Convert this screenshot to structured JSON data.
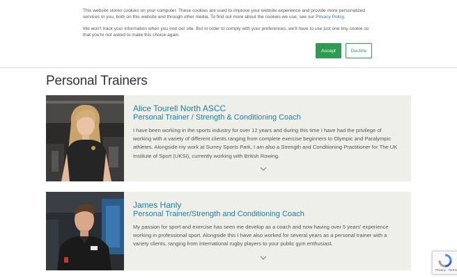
{
  "cookie_banner": {
    "paragraph_1_text": "This website stores cookies on your computer. These cookies are used to improve your website experience and provide more personalized services to you, both on this website and through other media. To find out more about the cookies we use, see our ",
    "policy_link": "Privacy Policy",
    "paragraph_1_end": ".",
    "paragraph_2": "We won't track your information when you visit our site. But in order to comply with your preferences, we'll have to use just one tiny cookie so that you're not asked to make this choice again.",
    "accept_label": "Accept",
    "decline_label": "Decline",
    "accept_color": "#2f9a54"
  },
  "page": {
    "section_title": "Personal Trainers"
  },
  "trainers": [
    {
      "name": "Alice Tourell North ASCC",
      "role": "Personal Trainer / Strength & Conditioning Coach",
      "bio": "I have been working in the sports industry for over 12 years and during this time I have had the privilege of working with a variety of different clients ranging from complete exercise beginners to Olympic and Paralympic athletes. Alongside my work at Surrey Sports Park, I am also a Strength and Conditioning Practitioner for The UK Institute of Sport (UKSI), currently working with British Rowing."
    },
    {
      "name": "James Hanly",
      "role": "Personal Trainer/Strength and Conditioning Coach",
      "bio": "My passion for sport and exercise has seen me develop as a coach and now having over 5 years' experience working in professional sport. Alongside this I have also worked for several years as a personal trainer with a variety clients, ranging from international rugby players to your public gym enthusiast."
    }
  ],
  "recaptcha": {
    "label": "Privacy - Terms"
  },
  "colors": {
    "heading_blue": "#1c7fa0",
    "card_bg": "#efefe9"
  }
}
